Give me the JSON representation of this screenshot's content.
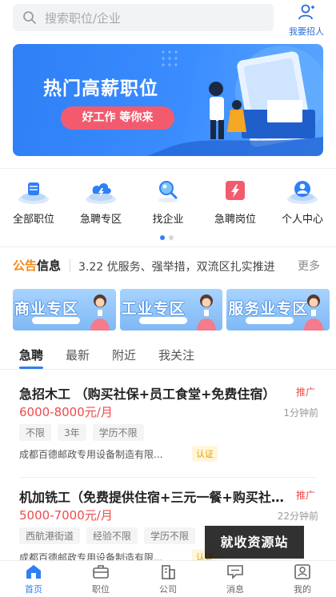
{
  "search": {
    "placeholder": "搜索职位/企业"
  },
  "header": {
    "recruit_label": "我要招人"
  },
  "banner": {
    "title": "热门高薪职位",
    "pill": "好工作 等你来"
  },
  "categories": [
    {
      "label": "全部职位",
      "icon": "database-icon"
    },
    {
      "label": "急聘专区",
      "icon": "cloud-lightning-icon"
    },
    {
      "label": "找企业",
      "icon": "search-icon"
    },
    {
      "label": "急聘岗位",
      "icon": "lightning-icon"
    },
    {
      "label": "个人中心",
      "icon": "user-icon"
    }
  ],
  "carousel": {
    "active_index": 0,
    "count": 2
  },
  "notice": {
    "tag_a": "公告",
    "tag_b": "信息",
    "text": "3.22 优服务、强举措，双流区扎实推进",
    "more": "更多"
  },
  "zones": [
    {
      "label": "商业专区"
    },
    {
      "label": "工业专区"
    },
    {
      "label": "服务业专区"
    }
  ],
  "tabs": [
    {
      "label": "急聘",
      "active": true
    },
    {
      "label": "最新",
      "active": false
    },
    {
      "label": "附近",
      "active": false
    },
    {
      "label": "我关注",
      "active": false
    }
  ],
  "jobs": [
    {
      "title": "急招木工 （购买社保+员工食堂+免费住宿）",
      "promo": "推广",
      "salary": "6000-8000元/月",
      "time": "1分钟前",
      "tags": [
        "不限",
        "3年",
        "学历不限"
      ],
      "company": "成都百德邮政专用设备制造有限...",
      "cert": "认证"
    },
    {
      "title": "机加铣工（免费提供住宿+三元一餐+购买社保）",
      "promo": "推广",
      "salary": "5000-7000元/月",
      "time": "22分钟前",
      "tags": [
        "西航港街道",
        "经验不限",
        "学历不限"
      ],
      "company": "成都百德邮政专用设备制造有限...",
      "cert": "认证"
    }
  ],
  "watermark": "就收资源站",
  "nav": [
    {
      "label": "首页",
      "icon": "home-icon",
      "active": true
    },
    {
      "label": "职位",
      "icon": "briefcase-icon",
      "active": false
    },
    {
      "label": "公司",
      "icon": "building-icon",
      "active": false
    },
    {
      "label": "消息",
      "icon": "message-icon",
      "active": false
    },
    {
      "label": "我的",
      "icon": "profile-icon",
      "active": false
    }
  ],
  "colors": {
    "accent": "#2f7ff5",
    "salary": "#f04a4a",
    "notice_orange": "#f28a1e"
  }
}
